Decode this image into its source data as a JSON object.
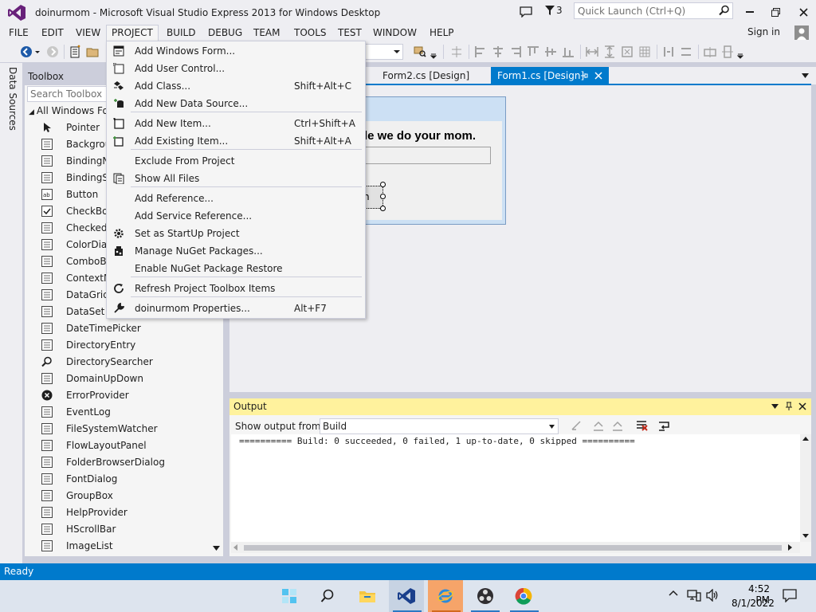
{
  "window": {
    "title": "doinurmom - Microsoft Visual Studio Express 2013 for Windows Desktop",
    "notification_count": "3",
    "quick_launch_placeholder": "Quick Launch (Ctrl+Q)"
  },
  "menubar": {
    "items": [
      "FILE",
      "EDIT",
      "VIEW",
      "PROJECT",
      "BUILD",
      "DEBUG",
      "TEAM",
      "TOOLS",
      "TEST",
      "WINDOW",
      "HELP"
    ],
    "open": "PROJECT",
    "sign_in": "Sign in"
  },
  "side_tabs": {
    "data_sources": "Data Sources"
  },
  "toolbox": {
    "title": "Toolbox",
    "search_placeholder": "Search Toolbox",
    "group": "All Windows Fo",
    "items": [
      "Pointer",
      "Backgrou",
      "BindingN",
      "BindingSo",
      "Button",
      "CheckBox",
      "CheckedL",
      "ColorDial",
      "ComboBo",
      "ContextM",
      "DataGridV",
      "DataSet",
      "DateTimePicker",
      "DirectoryEntry",
      "DirectorySearcher",
      "DomainUpDown",
      "ErrorProvider",
      "EventLog",
      "FileSystemWatcher",
      "FlowLayoutPanel",
      "FolderBrowserDialog",
      "FontDialog",
      "GroupBox",
      "HelpProvider",
      "HScrollBar",
      "ImageList"
    ]
  },
  "document_tabs": [
    {
      "label": "Form2.cs [Design]",
      "active": false
    },
    {
      "label": "Form1.cs [Design]",
      "active": true
    }
  ],
  "designer": {
    "form_label": "le we do your mom.",
    "button_text": "n"
  },
  "output": {
    "title": "Output",
    "show_from_label": "Show output from:",
    "source": "Build",
    "text": "========== Build: 0 succeeded, 0 failed, 1 up-to-date, 0 skipped =========="
  },
  "status": {
    "text": "Ready"
  },
  "taskbar": {
    "time": "4:52 PM",
    "date": "8/1/2022"
  },
  "project_menu": [
    {
      "label": "Add Windows Form...",
      "shortcut": "",
      "icon": "windows-form-icon"
    },
    {
      "label": "Add User Control...",
      "shortcut": "",
      "icon": "user-control-icon"
    },
    {
      "label": "Add Class...",
      "shortcut": "Shift+Alt+C",
      "icon": "class-icon"
    },
    {
      "label": "Add New Data Source...",
      "shortcut": "",
      "icon": "data-source-icon"
    },
    {
      "label": "Add New Item...",
      "shortcut": "Ctrl+Shift+A",
      "icon": "new-item-icon"
    },
    {
      "label": "Add Existing Item...",
      "shortcut": "Shift+Alt+A",
      "icon": "existing-item-icon"
    },
    {
      "label": "Exclude From Project",
      "shortcut": "",
      "icon": ""
    },
    {
      "label": "Show All Files",
      "shortcut": "",
      "icon": "show-all-files-icon"
    },
    {
      "label": "Add Reference...",
      "shortcut": "",
      "icon": ""
    },
    {
      "label": "Add Service Reference...",
      "shortcut": "",
      "icon": ""
    },
    {
      "label": "Set as StartUp Project",
      "shortcut": "",
      "icon": "gear-icon"
    },
    {
      "label": "Manage NuGet Packages...",
      "shortcut": "",
      "icon": "nuget-icon"
    },
    {
      "label": "Enable NuGet Package Restore",
      "shortcut": "",
      "icon": ""
    },
    {
      "label": "Refresh Project Toolbox Items",
      "shortcut": "",
      "icon": "refresh-icon"
    },
    {
      "label": "doinurmom Properties...",
      "shortcut": "Alt+F7",
      "icon": "wrench-icon"
    }
  ],
  "colors": {
    "accent": "#007ACC",
    "vs_purple": "#68217A",
    "output_header": "#FFF29D",
    "menu_bg": "#F5F5F5"
  }
}
